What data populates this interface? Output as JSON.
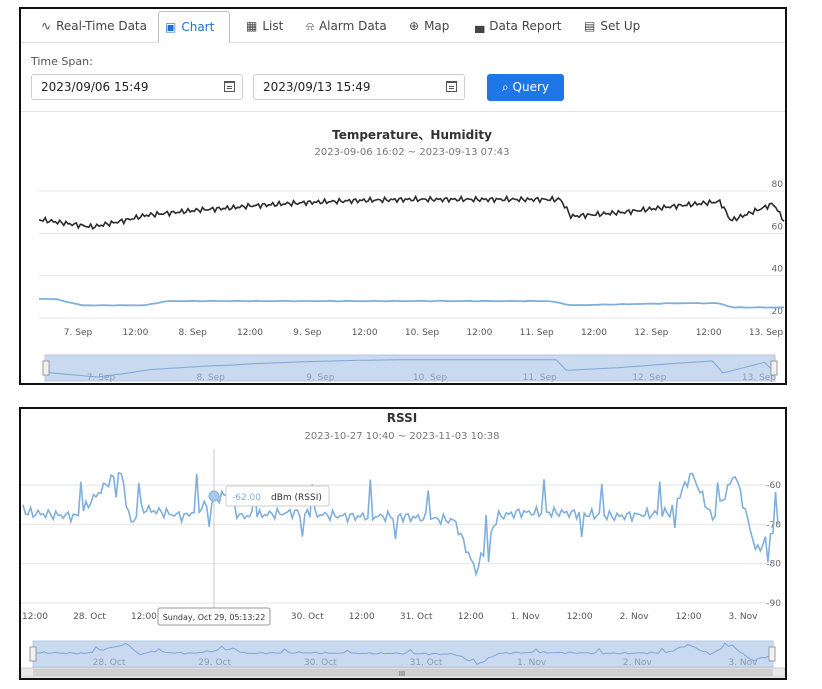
{
  "tabs": [
    {
      "label": "Real-Time Data",
      "icon": "pulse-icon"
    },
    {
      "label": "Chart",
      "icon": "chart-icon",
      "active": true
    },
    {
      "label": "List",
      "icon": "table-icon"
    },
    {
      "label": "Alarm Data",
      "icon": "bell-icon"
    },
    {
      "label": "Map",
      "icon": "globe-icon"
    },
    {
      "label": "Data Report",
      "icon": "bar-report-icon"
    },
    {
      "label": "Set Up",
      "icon": "terminal-icon"
    }
  ],
  "query": {
    "time_span_label": "Time Span:",
    "start": "2023/09/06 15:49",
    "end": "2023/09/13 15:49",
    "button_label": "Query"
  },
  "chart_data": [
    {
      "type": "line",
      "title": "Temperature、Humidity",
      "subtitle": "2023-09-06 16:02 ~ 2023-09-13 07:43",
      "x_ticks": [
        "7. Sep",
        "12:00",
        "8. Sep",
        "12:00",
        "9. Sep",
        "12:00",
        "10. Sep",
        "12:00",
        "11. Sep",
        "12:00",
        "12. Sep",
        "12:00",
        "13. Sep"
      ],
      "y_ticks": [
        "80",
        "60",
        "40",
        "20"
      ],
      "ylim": [
        20,
        80
      ],
      "navigator_labels": [
        "7. Sep",
        "8. Sep",
        "9. Sep",
        "10. Sep",
        "11. Sep",
        "12. Sep",
        "13. Sep"
      ],
      "colors": {
        "series_dark": "#2b2b2b",
        "series_blue": "#7fb0dd"
      },
      "series": [
        {
          "color": "#2b2b2b",
          "x": [
            0,
            0.5,
            0.8,
            1,
            1.5,
            1.8,
            2,
            2.5,
            3,
            3.5,
            4,
            4.5,
            4.9,
            5,
            5.5,
            6,
            6.4,
            6.5,
            6.9,
            7
          ],
          "values": [
            66.5,
            63,
            66,
            68.5,
            71,
            72,
            73,
            74.5,
            75.5,
            76,
            76,
            76,
            76,
            68,
            70,
            73,
            75,
            66,
            74,
            66
          ]
        },
        {
          "color": "#7fb0dd",
          "x": [
            0,
            0.15,
            0.4,
            1,
            1.2,
            2,
            3,
            4,
            4.8,
            5,
            6,
            6.4,
            6.5,
            7
          ],
          "values": [
            29,
            29,
            26,
            26,
            28,
            28,
            28,
            28,
            28,
            26,
            27,
            27,
            25,
            25
          ]
        }
      ]
    },
    {
      "type": "line",
      "title": "RSSI",
      "subtitle": "2023-10-27 10:40 ~ 2023-11-03 10:38",
      "x_ticks": [
        "12:00",
        "28. Oct",
        "12:00",
        "29. Oct",
        "12:00",
        "30. Oct",
        "12:00",
        "31. Oct",
        "12:00",
        "1. Nov",
        "12:00",
        "2. Nov",
        "12:00",
        "3. Nov"
      ],
      "y_ticks": [
        "-60",
        "-70",
        "-80",
        "-90"
      ],
      "ylim": [
        -90,
        -60
      ],
      "tooltip": {
        "value": "-62.00",
        "unit": "dBm (RSSI)",
        "date": "Sunday, Oct 29, 05:13:22"
      },
      "navigator_labels": [
        "28. Oct",
        "29. Oct",
        "30. Oct",
        "31. Oct",
        "1. Nov",
        "2. Nov",
        "3. Nov"
      ],
      "navigator_handle": "III",
      "colors": {
        "series": "#7fb0dd"
      },
      "series": [
        {
          "color": "#7fb0dd",
          "x": [
            0,
            0.5,
            0.9,
            1,
            1.1,
            1.5,
            1.9,
            2,
            2.5,
            3,
            3.5,
            4,
            4.2,
            4.4,
            4.6,
            5,
            5.5,
            6,
            6.2,
            6.4,
            6.6,
            6.8,
            7
          ],
          "values": [
            -67,
            -68,
            -56,
            -70,
            -66,
            -68,
            -62,
            -68,
            -67,
            -68,
            -68,
            -69,
            -82,
            -68,
            -67,
            -67,
            -68,
            -67,
            -57,
            -69,
            -57,
            -77,
            -70
          ]
        }
      ]
    }
  ]
}
